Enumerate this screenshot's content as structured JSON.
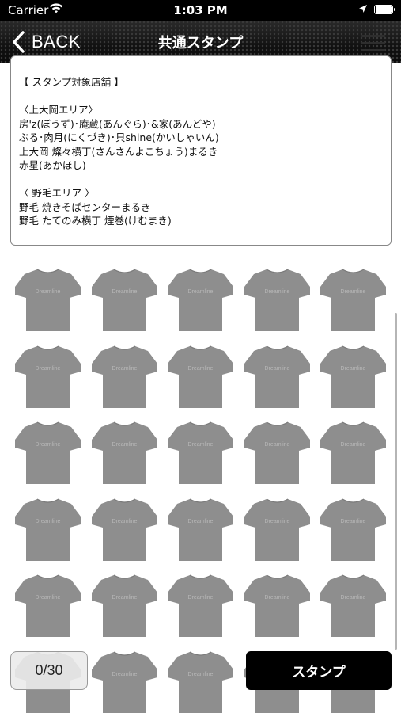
{
  "status_bar": {
    "carrier": "Carrier",
    "time": "1:03 PM"
  },
  "nav": {
    "back_label": "BACK",
    "title": "共通スタンプ"
  },
  "info": {
    "lines": [
      "【 スタンプ対象店舗 】",
      "",
      "〈上大岡エリア〉",
      "房'z(ぼうず)･庵蔵(あんぐら)･&家(あんどや)",
      "ぶる･肉月(にくづき)･貝shine(かいしゃいん)",
      "上大岡 燦々横丁(さんさんよこちょう)まるき",
      "赤星(あかほし)",
      "",
      "〈 野毛エリア 〉",
      "野毛 焼きそばセンターまるき",
      "野毛 たてのみ横丁 煙巻(けむまき)"
    ]
  },
  "stamps": {
    "total": 30,
    "collected": 0,
    "columns": 5,
    "shirt_print": "Dreamline"
  },
  "footer": {
    "counter": "0/30",
    "stamp_button": "スタンプ"
  },
  "colors": {
    "nav_bg": "#1c1c1c",
    "shirt": "#8e8e8e",
    "button_bg": "#000000"
  }
}
